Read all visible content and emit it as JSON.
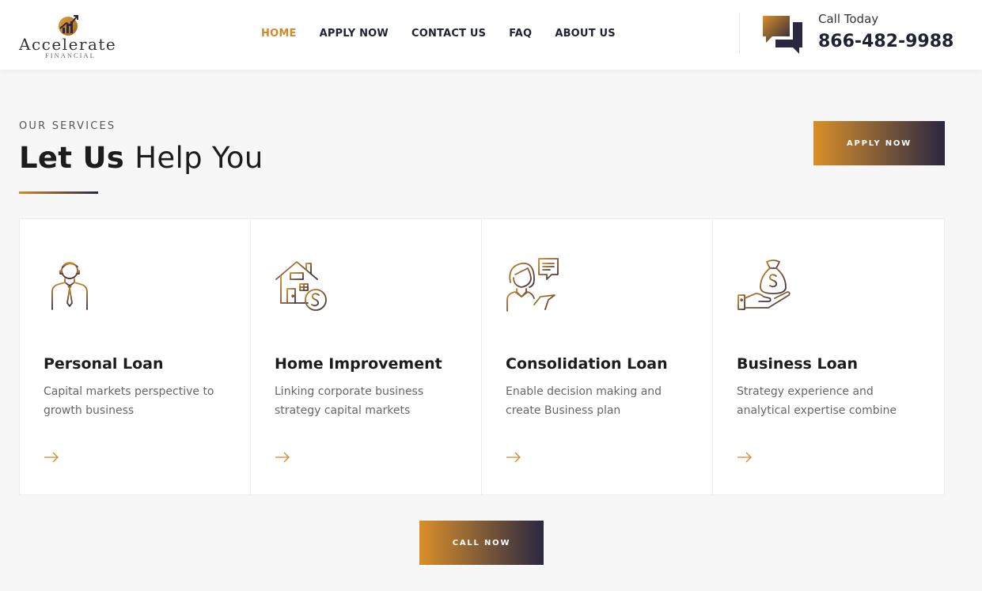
{
  "brand": {
    "name": "Accelerate",
    "sub": "FINANCIAL",
    "colors": {
      "accent": "#d08a2c",
      "dark": "#2a2740"
    }
  },
  "nav": {
    "items": [
      {
        "label": "HOME",
        "active": true
      },
      {
        "label": "APPLY NOW",
        "active": false
      },
      {
        "label": "CONTACT US",
        "active": false
      },
      {
        "label": "FAQ",
        "active": false
      },
      {
        "label": "ABOUT US",
        "active": false
      }
    ]
  },
  "contact": {
    "label": "Call Today",
    "number": "866-482-9988",
    "icon": "chat-bubbles-icon"
  },
  "section": {
    "eyebrow": "OUR SERVICES",
    "headline_bold": "Let Us",
    "headline_light": "Help You",
    "apply_label": "APPLY NOW",
    "call_label": "CALL NOW"
  },
  "services": [
    {
      "title": "Personal Loan",
      "desc": "Capital markets perspective to growth business",
      "icon": "businessman-icon"
    },
    {
      "title": "Home Improvement",
      "desc": "Linking corporate business strategy capital markets",
      "icon": "house-dollar-icon"
    },
    {
      "title": "Consolidation Loan",
      "desc": "Enable decision making and create Business plan",
      "icon": "consultant-chat-icon"
    },
    {
      "title": "Business Loan",
      "desc": "Strategy experience and analytical expertise combine",
      "icon": "money-bag-hand-icon"
    }
  ]
}
